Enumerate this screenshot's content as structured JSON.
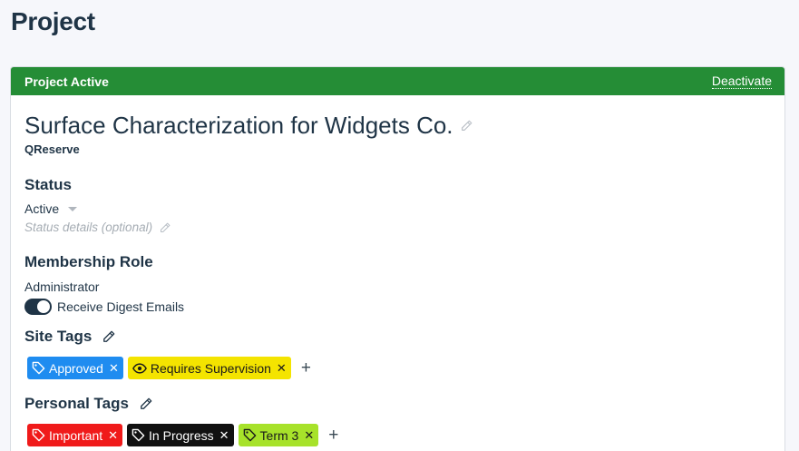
{
  "page": {
    "title": "Project"
  },
  "header": {
    "status": "Project Active",
    "deactivate_label": "Deactivate",
    "color": "#258d36"
  },
  "project": {
    "name": "Surface Characterization for Widgets Co.",
    "organization": "QReserve"
  },
  "status": {
    "heading": "Status",
    "value": "Active",
    "details_placeholder": "Status details (optional)"
  },
  "membership": {
    "heading": "Membership Role",
    "role": "Administrator",
    "digest_label": "Receive Digest Emails",
    "digest_enabled": true
  },
  "site_tags": {
    "heading": "Site Tags",
    "tags": [
      {
        "label": "Approved",
        "icon": "tag-icon",
        "color": "#1f8cf0"
      },
      {
        "label": "Requires Supervision",
        "icon": "eye-icon",
        "color": "#f4e400"
      }
    ],
    "add_label": "+"
  },
  "personal_tags": {
    "heading": "Personal Tags",
    "tags": [
      {
        "label": "Important",
        "icon": "tag-icon",
        "color": "#f01a1a"
      },
      {
        "label": "In Progress",
        "icon": "tag-icon",
        "color": "#111111"
      },
      {
        "label": "Term 3",
        "icon": "tag-icon",
        "color": "#a7e22a"
      }
    ],
    "add_label": "+"
  },
  "remove_glyph": "✕"
}
